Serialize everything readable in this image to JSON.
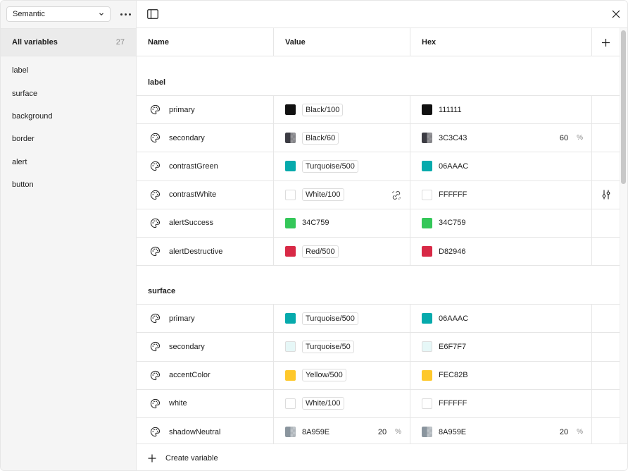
{
  "sidebar": {
    "collection_select": "Semantic",
    "all_variables": {
      "label": "All variables",
      "count": "27"
    },
    "groups": [
      "label",
      "surface",
      "background",
      "border",
      "alert",
      "button"
    ]
  },
  "table": {
    "headers": {
      "name": "Name",
      "value": "Value",
      "hex": "Hex"
    },
    "groups": [
      {
        "title": "label",
        "rows": [
          {
            "name": "primary",
            "value": "Black/100",
            "value_type": "alias",
            "color": "#111111",
            "hex": "111111",
            "opacity": ""
          },
          {
            "name": "secondary",
            "value": "Black/60",
            "value_type": "alias",
            "color": "#3C3C43",
            "hex": "3C3C43",
            "opacity": "60",
            "half": true
          },
          {
            "name": "contrastGreen",
            "value": "Turquoise/500",
            "value_type": "alias",
            "color": "#06AAAC",
            "hex": "06AAAC",
            "opacity": ""
          },
          {
            "name": "contrastWhite",
            "value": "White/100",
            "value_type": "alias",
            "color": "#FFFFFF",
            "hex": "FFFFFF",
            "opacity": "",
            "hover": true
          },
          {
            "name": "alertSuccess",
            "value": "34C759",
            "value_type": "raw",
            "color": "#34C759",
            "hex": "34C759",
            "opacity": ""
          },
          {
            "name": "alertDestructive",
            "value": "Red/500",
            "value_type": "alias",
            "color": "#D82946",
            "hex": "D82946",
            "opacity": ""
          }
        ]
      },
      {
        "title": "surface",
        "rows": [
          {
            "name": "primary",
            "value": "Turquoise/500",
            "value_type": "alias",
            "color": "#06AAAC",
            "hex": "06AAAC",
            "opacity": ""
          },
          {
            "name": "secondary",
            "value": "Turquoise/50",
            "value_type": "alias",
            "color": "#E6F7F7",
            "hex": "E6F7F7",
            "opacity": ""
          },
          {
            "name": "accentColor",
            "value": "Yellow/500",
            "value_type": "alias",
            "color": "#FEC82B",
            "hex": "FEC82B",
            "opacity": ""
          },
          {
            "name": "white",
            "value": "White/100",
            "value_type": "alias",
            "color": "#FFFFFF",
            "hex": "FFFFFF",
            "opacity": ""
          },
          {
            "name": "shadowNeutral",
            "value": "8A959E",
            "value_type": "raw",
            "color": "#8A959E",
            "hex": "8A959E",
            "opacity": "20",
            "value_opacity": "20",
            "half": true
          }
        ]
      }
    ],
    "percent_symbol": "%"
  },
  "footer": {
    "create_label": "Create variable"
  },
  "icons": {
    "palette": "palette-icon",
    "link_break": "unlink-icon",
    "adjust": "sliders-icon",
    "panel": "sidebar-toggle-icon",
    "close": "close-icon",
    "more": "more-icon",
    "add": "plus-icon"
  }
}
